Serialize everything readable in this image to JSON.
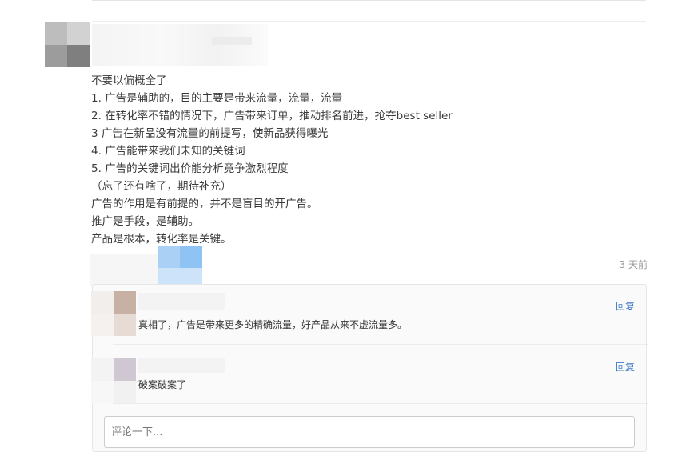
{
  "post": {
    "lines": [
      "不要以偏概全了",
      "1. 广告是辅助的，目的主要是带来流量，流量，流量",
      "2. 在转化率不错的情况下，广告带来订单，推动排名前进，抢夺best seller",
      "3 广告在新品没有流量的前提写，使新品获得曝光",
      "4. 广告能带来我们未知的关键词",
      "5. 广告的关键词出价能分析竟争激烈程度",
      "（忘了还有啥了，期待补充）",
      "广告的作用是有前提的，并不是盲目的开广告。",
      "推广是手段，是辅助。",
      "产品是根本，转化率是关键。"
    ],
    "timestamp": "3 天前"
  },
  "comments": [
    {
      "text": "真相了，广告是带来更多的精确流量，好产品从来不虚流量多。",
      "reply_label": "回复"
    },
    {
      "text": "破案破案了",
      "reply_label": "回复"
    }
  ],
  "comment_input": {
    "placeholder": "评论一下..."
  },
  "colors": {
    "link": "#3c78c3",
    "muted": "#999999",
    "text": "#333333",
    "border": "#e6e6e6"
  }
}
